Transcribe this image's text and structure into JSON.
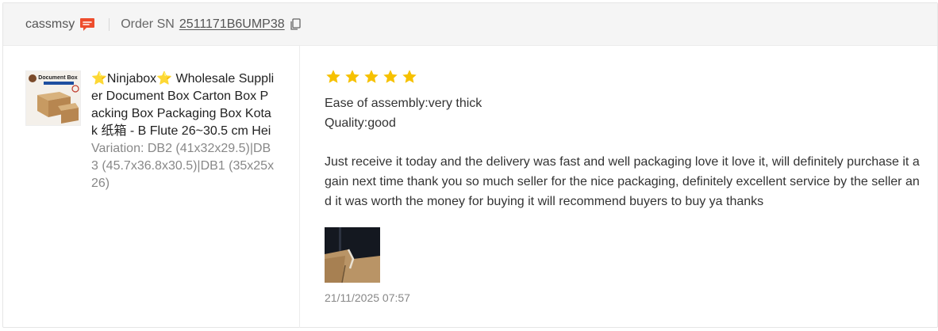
{
  "header": {
    "buyer_name": "cassmsy",
    "order_label": "Order SN",
    "order_sn": "2511171B6UMP38"
  },
  "product": {
    "name": "⭐Ninjabox⭐ Wholesale Supplier Document Box Carton Box Packing Box Packaging Box Kotak 纸箱 - B Flute 26~30.5 cm Hei",
    "variation": "Variation: DB2 (41x32x29.5)|DB3 (45.7x36.8x30.5)|DB1 (35x25x26)",
    "thumb_title": "Document Box"
  },
  "review": {
    "rating": 5,
    "attributes": [
      "Ease of assembly:very thick",
      "Quality:good"
    ],
    "text": "Just receive it today and the delivery was fast and well packaging love it love it, will definitely purchase it again next time thank you so much seller for the nice packaging, definitely excellent service by the seller and it was worth the money for buying it will recommend buyers to buy ya thanks",
    "timestamp": "21/11/2025 07:57"
  },
  "colors": {
    "star": "#f6c100",
    "chat_icon": "#ee4d2d"
  }
}
